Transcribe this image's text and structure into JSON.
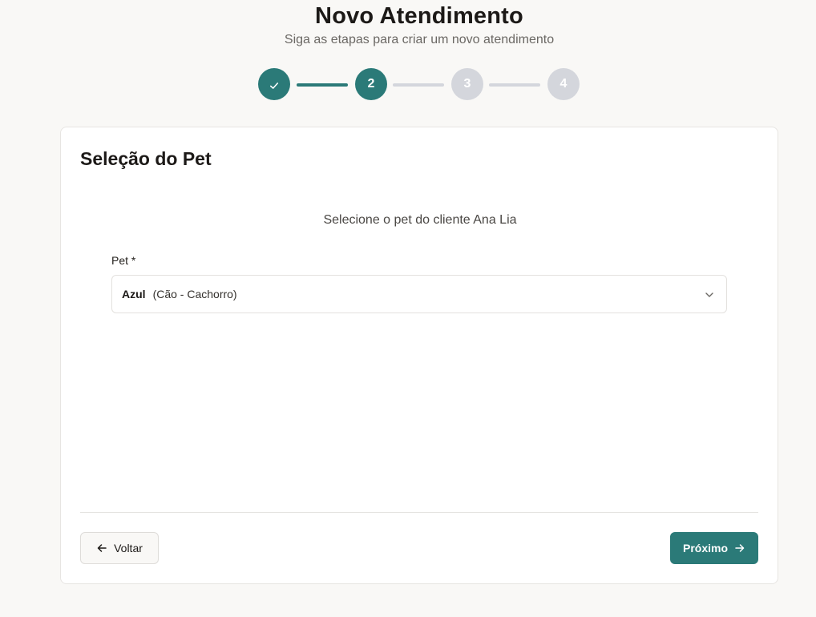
{
  "header": {
    "title": "Novo Atendimento",
    "subtitle": "Siga as etapas para criar um novo atendimento"
  },
  "stepper": {
    "steps": [
      {
        "label": "",
        "state": "done",
        "icon": "check-icon"
      },
      {
        "label": "2",
        "state": "active"
      },
      {
        "label": "3",
        "state": "pending"
      },
      {
        "label": "4",
        "state": "pending"
      }
    ],
    "colors": {
      "done": "#2b7a78",
      "pending": "#d4d6dc"
    }
  },
  "card": {
    "title": "Seleção do Pet",
    "prompt": "Selecione o pet do cliente Ana Lia",
    "pet_field": {
      "label": "Pet *",
      "selected_name": "Azul",
      "selected_desc": "(Cão - Cachorro)",
      "icon": "chevron-down-icon"
    }
  },
  "actions": {
    "back_label": "Voltar",
    "back_icon": "arrow-left-icon",
    "next_label": "Próximo",
    "next_icon": "arrow-right-icon",
    "accent_color": "#2b7a78"
  }
}
